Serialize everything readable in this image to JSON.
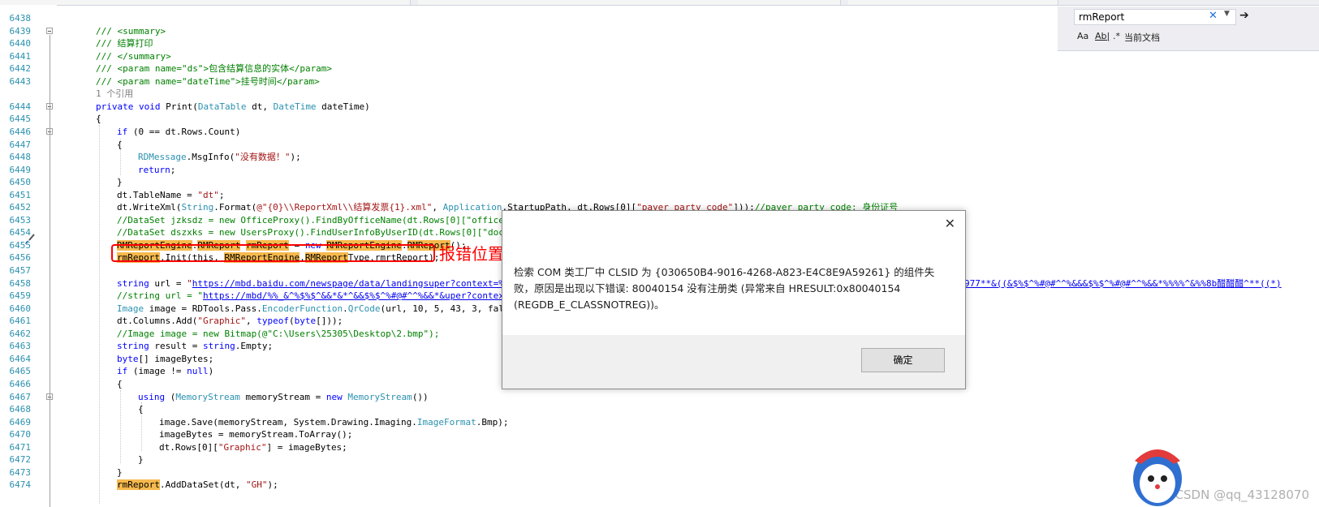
{
  "editor": {
    "lines": [
      {
        "n": "6438",
        "parts": []
      },
      {
        "n": "6439",
        "parts": [
          [
            "cm",
            "/// <summary>"
          ]
        ]
      },
      {
        "n": "6440",
        "parts": [
          [
            "cm",
            "/// 结算打印"
          ]
        ]
      },
      {
        "n": "6441",
        "parts": [
          [
            "cm",
            "/// </summary>"
          ]
        ]
      },
      {
        "n": "6442",
        "parts": [
          [
            "cm",
            "/// <param name=\"ds\">包含结算信息的实体</param>"
          ]
        ]
      },
      {
        "n": "6443",
        "parts": [
          [
            "cm",
            "/// <param name=\"dateTime\">挂号时间</param>"
          ]
        ]
      },
      {
        "n": "",
        "parts": [
          [
            "xg",
            "1 个引用"
          ]
        ]
      },
      {
        "n": "6444",
        "parts": [
          [
            "kw",
            "private void "
          ],
          [
            "",
            "Print("
          ],
          [
            "ty",
            "DataTable"
          ],
          [
            "",
            " dt, "
          ],
          [
            "ty",
            "DateTime"
          ],
          [
            "",
            " dateTime)"
          ]
        ]
      },
      {
        "n": "6445",
        "parts": [
          [
            "",
            "{"
          ]
        ]
      },
      {
        "n": "6446",
        "parts": [
          [
            "kw",
            "if"
          ],
          [
            "",
            " (0 == dt.Rows.Count)"
          ]
        ]
      },
      {
        "n": "6447",
        "parts": [
          [
            "",
            "{"
          ]
        ]
      },
      {
        "n": "6448",
        "parts": [
          [
            "ty",
            "RDMessage"
          ],
          [
            "",
            ".MsgInfo("
          ],
          [
            "st",
            "\"没有数据！\""
          ],
          [
            "",
            ");"
          ]
        ]
      },
      {
        "n": "6449",
        "parts": [
          [
            "kw",
            "return"
          ],
          [
            "",
            ";"
          ]
        ]
      },
      {
        "n": "6450",
        "parts": [
          [
            "",
            "}"
          ]
        ]
      },
      {
        "n": "6451",
        "parts": [
          [
            "",
            "dt.TableName = "
          ],
          [
            "st",
            "\"dt\""
          ],
          [
            "",
            ";"
          ]
        ]
      },
      {
        "n": "6452",
        "parts": [
          [
            "",
            "dt.WriteXml("
          ],
          [
            "ty",
            "String"
          ],
          [
            "",
            ".Format("
          ],
          [
            "st",
            "@\"{0}\\\\ReportXml\\\\结算发票{1}.xml\""
          ],
          [
            "",
            ", "
          ],
          [
            "ty",
            "Application"
          ],
          [
            "",
            ".StartupPath, dt.Rows[0]["
          ],
          [
            "st",
            "\"payer_party_code\""
          ],
          [
            "",
            "]));"
          ],
          [
            "cm",
            "//payer_party_code: 身份证号"
          ]
        ]
      },
      {
        "n": "6453",
        "parts": [
          [
            "cm",
            "//DataSet jzksdz = new OfficeProxy().FindByOfficeName(dt.Rows[0][\"office\"]."
          ]
        ]
      },
      {
        "n": "6454",
        "parts": [
          [
            "cm",
            "//DataSet dszxks = new UsersProxy().FindUserInfoByUserID(dt.Rows[0][\"doctor"
          ]
        ]
      },
      {
        "n": "6455",
        "parts": [
          [
            "hl",
            "RMReportEngine"
          ],
          [
            "",
            "."
          ],
          [
            "hl",
            "RMReport"
          ],
          [
            "",
            " "
          ],
          [
            "hl",
            "rmReport"
          ],
          [
            "",
            " = "
          ],
          [
            "kw",
            "new "
          ],
          [
            "hl",
            "RMReportEngine"
          ],
          [
            "",
            "."
          ],
          [
            "hl",
            "RMReport"
          ],
          [
            "",
            "();"
          ]
        ]
      },
      {
        "n": "6456",
        "parts": [
          [
            "hl",
            "rmReport"
          ],
          [
            "",
            ".Init(this, "
          ],
          [
            "hl",
            "RMReportEngine"
          ],
          [
            "",
            "."
          ],
          [
            "hl",
            "RMReport"
          ],
          [
            "",
            "Type.rmrtReport);"
          ]
        ]
      },
      {
        "n": "6457",
        "parts": []
      },
      {
        "n": "6458",
        "parts": [
          [
            "kw",
            "string"
          ],
          [
            "",
            " url = "
          ],
          [
            "st",
            "\""
          ],
          [
            "lk",
            "https://mbd.baidu.com/newspage/data/landingsuper?context=%7B%"
          ]
        ]
      },
      {
        "n": "6459",
        "parts": [
          [
            "cm",
            "//string url = \""
          ],
          [
            "lk",
            "https://mbd/%%_&^%$%$^&&*&*^&&$%$^%#@#^^%&&*&uper?context=%"
          ]
        ]
      },
      {
        "n": "6460",
        "parts": [
          [
            "ty",
            "Image"
          ],
          [
            "",
            " image = RDTools.Pass."
          ],
          [
            "ty",
            "EncoderFunction"
          ],
          [
            "",
            "."
          ],
          [
            "ty",
            "QrCode"
          ],
          [
            "",
            "(url, 10, 5, 43, 3, false)"
          ]
        ]
      },
      {
        "n": "6461",
        "parts": [
          [
            "",
            "dt.Columns.Add("
          ],
          [
            "st",
            "\"Graphic\""
          ],
          [
            "",
            ", "
          ],
          [
            "kw",
            "typeof"
          ],
          [
            "",
            "("
          ],
          [
            "kw",
            "byte"
          ],
          [
            "",
            "[]));"
          ]
        ]
      },
      {
        "n": "6462",
        "parts": [
          [
            "cm",
            "//Image image = new Bitmap(@\"C:\\Users\\25305\\Desktop\\2.bmp\");"
          ]
        ]
      },
      {
        "n": "6463",
        "parts": [
          [
            "kw",
            "string"
          ],
          [
            "",
            " result = "
          ],
          [
            "kw",
            "string"
          ],
          [
            "",
            ".Empty;"
          ]
        ]
      },
      {
        "n": "6464",
        "parts": [
          [
            "kw",
            "byte"
          ],
          [
            "",
            "[] imageBytes;"
          ]
        ]
      },
      {
        "n": "6465",
        "parts": [
          [
            "kw",
            "if"
          ],
          [
            "",
            " (image != "
          ],
          [
            "kw",
            "null"
          ],
          [
            "",
            ")"
          ]
        ]
      },
      {
        "n": "6466",
        "parts": [
          [
            "",
            "{"
          ]
        ]
      },
      {
        "n": "6467",
        "parts": [
          [
            "kw",
            "using"
          ],
          [
            "",
            " ("
          ],
          [
            "ty",
            "MemoryStream"
          ],
          [
            "",
            " memoryStream = "
          ],
          [
            "kw",
            "new "
          ],
          [
            "ty",
            "MemoryStream"
          ],
          [
            "",
            "())"
          ]
        ]
      },
      {
        "n": "6468",
        "parts": [
          [
            "",
            "{"
          ]
        ]
      },
      {
        "n": "6469",
        "parts": [
          [
            "",
            "image.Save(memoryStream, System.Drawing.Imaging."
          ],
          [
            "ty",
            "ImageFormat"
          ],
          [
            "",
            ".Bmp);"
          ]
        ]
      },
      {
        "n": "6470",
        "parts": [
          [
            "",
            "imageBytes = memoryStream.ToArray();"
          ]
        ]
      },
      {
        "n": "6471",
        "parts": [
          [
            "",
            "dt.Rows[0]["
          ],
          [
            "st",
            "\"Graphic\""
          ],
          [
            "",
            "] = imageBytes;"
          ]
        ]
      },
      {
        "n": "6472",
        "parts": [
          [
            "",
            "}"
          ]
        ]
      },
      {
        "n": "6473",
        "parts": [
          [
            "",
            "}"
          ]
        ]
      },
      {
        "n": "6474",
        "parts": [
          [
            "hl",
            "rmReport"
          ],
          [
            "",
            ".AddDataSet(dt, "
          ],
          [
            "st",
            "\"GH\""
          ],
          [
            "",
            ");"
          ]
        ]
      }
    ],
    "overflow_text": "977**&((&$%$^%#@#^^%&&&$%$^%#@#^^%&&*%%%%^&%%8b醋醋醋^**((*)"
  },
  "annotation": {
    "error_label": "报错位置"
  },
  "find": {
    "query": "rmReport",
    "clear_icon": "✕",
    "next_icon": "➔",
    "opt_case": "Aa",
    "opt_word": "Ab|",
    "opt_regex": ".*",
    "scope": "当前文档"
  },
  "dialog": {
    "message": "检索 COM 类工厂中 CLSID 为 {030650B4-9016-4268-A823-E4C8E9A59261} 的组件失败，原因是出现以下错误: 80040154 没有注册类 (异常来自 HRESULT:0x80040154 (REGDB_E_CLASSNOTREG))。",
    "ok_label": "确定"
  },
  "watermark": "CSDN @qq_43128070",
  "colors": {
    "error_red": "#ff0000",
    "highlight": "#f6b94d",
    "keyword": "#0000ff",
    "type": "#2b91af",
    "comment": "#008000",
    "string": "#a31515"
  }
}
